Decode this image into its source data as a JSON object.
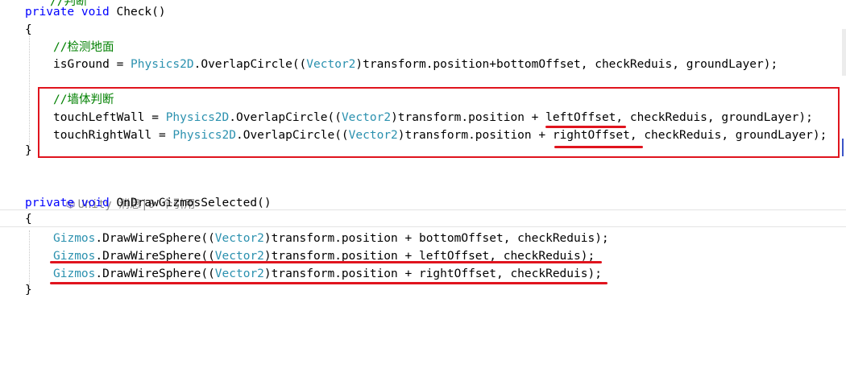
{
  "top_fragment": "//判断",
  "method1": {
    "signature_kw": "private void ",
    "signature_name": "Check()",
    "open_brace": "{",
    "comment_ground": "//检测地面",
    "ground_assign": "isGround = ",
    "physics": "Physics2D",
    "overlap": ".OverlapCircle((",
    "vector2": "Vector2",
    "ground_rest": ")transform.position+bottomOffset, checkReduis, groundLayer);",
    "comment_wall": "//墙体判断",
    "left_assign": "touchLeftWall = ",
    "left_rest": ")transform.position + leftOffset, checkReduis, groundLayer);",
    "right_assign": "touchRightWall = ",
    "right_rest": ")transform.position + rightOffset, checkReduis, groundLayer);",
    "close_brace": "}"
  },
  "codelens": "Unity 消息|0 个引用",
  "method2": {
    "signature_kw": "private void ",
    "signature_name": "OnDrawGizmosSelected()",
    "open_brace": "{",
    "gizmos": "Gizmos",
    "draw": ".DrawWireSphere((",
    "vector2": "Vector2",
    "line1_rest": ")transform.position + bottomOffset, checkReduis);",
    "line2_rest": ")transform.position + leftOffset, checkReduis);",
    "line3_rest": ")transform.position + rightOffset, checkReduis);",
    "close_brace": "}"
  },
  "colors": {
    "keyword": "#0000ff",
    "comment": "#008000",
    "type": "#2b91af",
    "annotation": "#e0141e"
  },
  "icons": [
    "unity-cube-icon"
  ]
}
